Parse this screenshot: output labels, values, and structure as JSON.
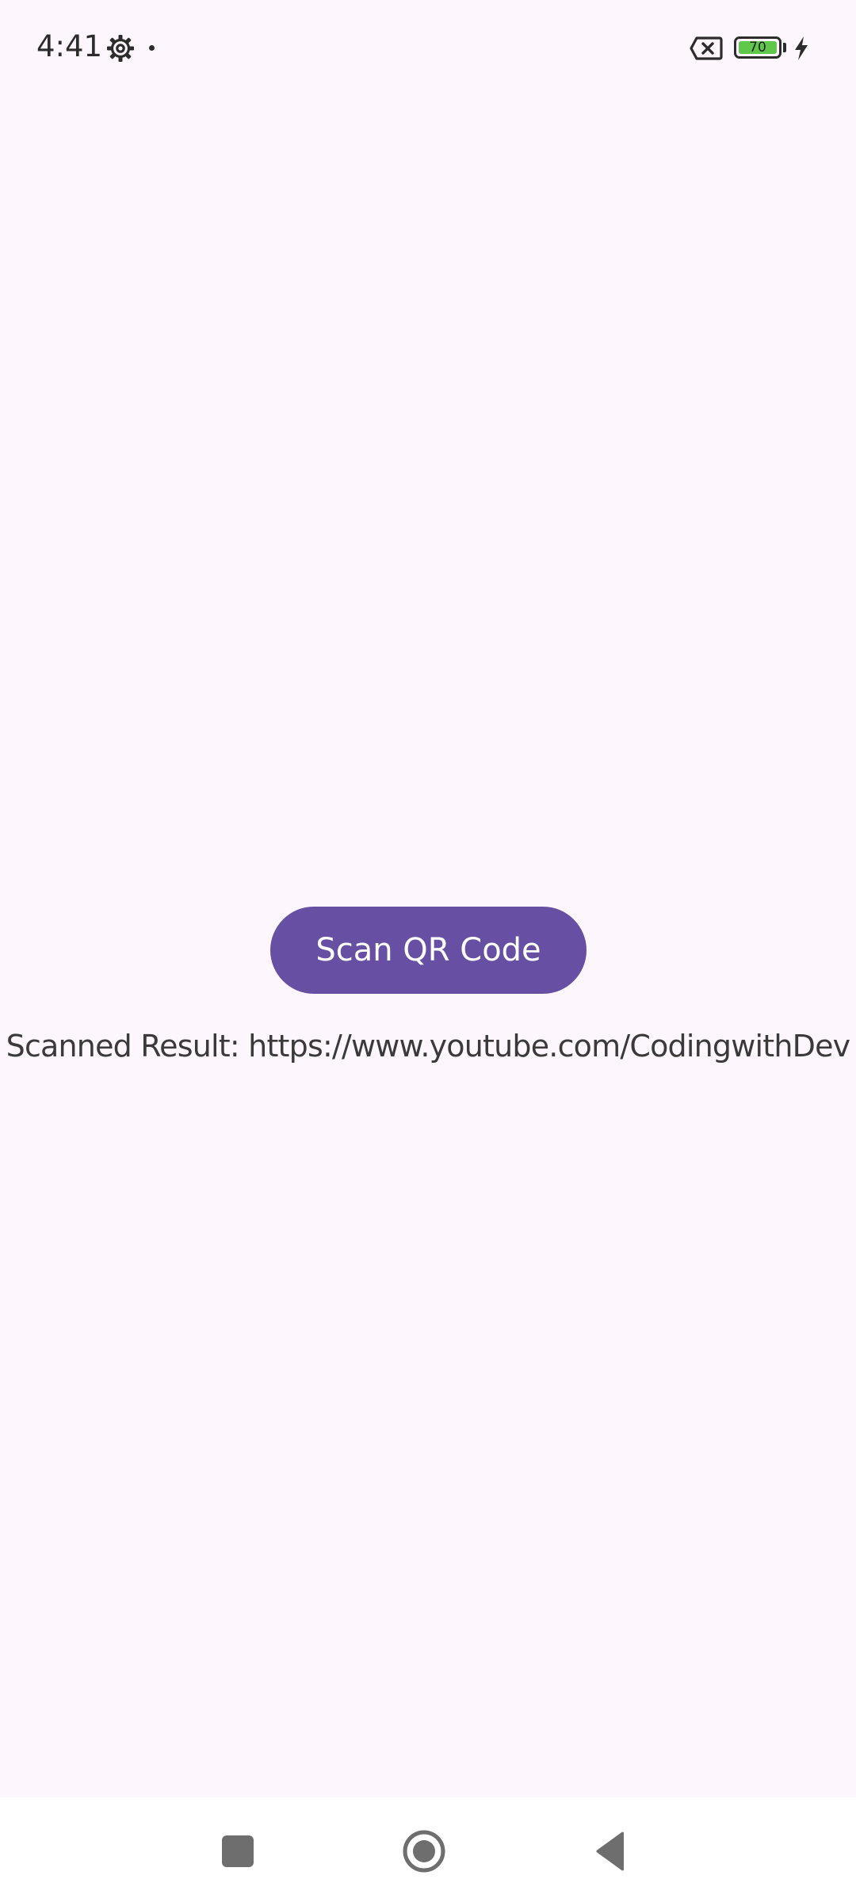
{
  "status_bar": {
    "time": "4:41",
    "battery_level": "70",
    "icons": [
      "settings-gear-icon",
      "notification-dot-icon",
      "no-sim-icon",
      "battery-icon",
      "charging-bolt-icon"
    ]
  },
  "main": {
    "scan_button_label": "Scan QR Code",
    "result_text": "Scanned Result: https://www.youtube.com/CodingwithDev"
  },
  "nav_bar": {
    "icons": [
      "recents-square-icon",
      "home-circle-icon",
      "back-triangle-icon"
    ]
  },
  "colors": {
    "background": "#fdf7fd",
    "accent": "#6750a4",
    "text": "#3a3a3a",
    "battery": "#5fc84a"
  }
}
